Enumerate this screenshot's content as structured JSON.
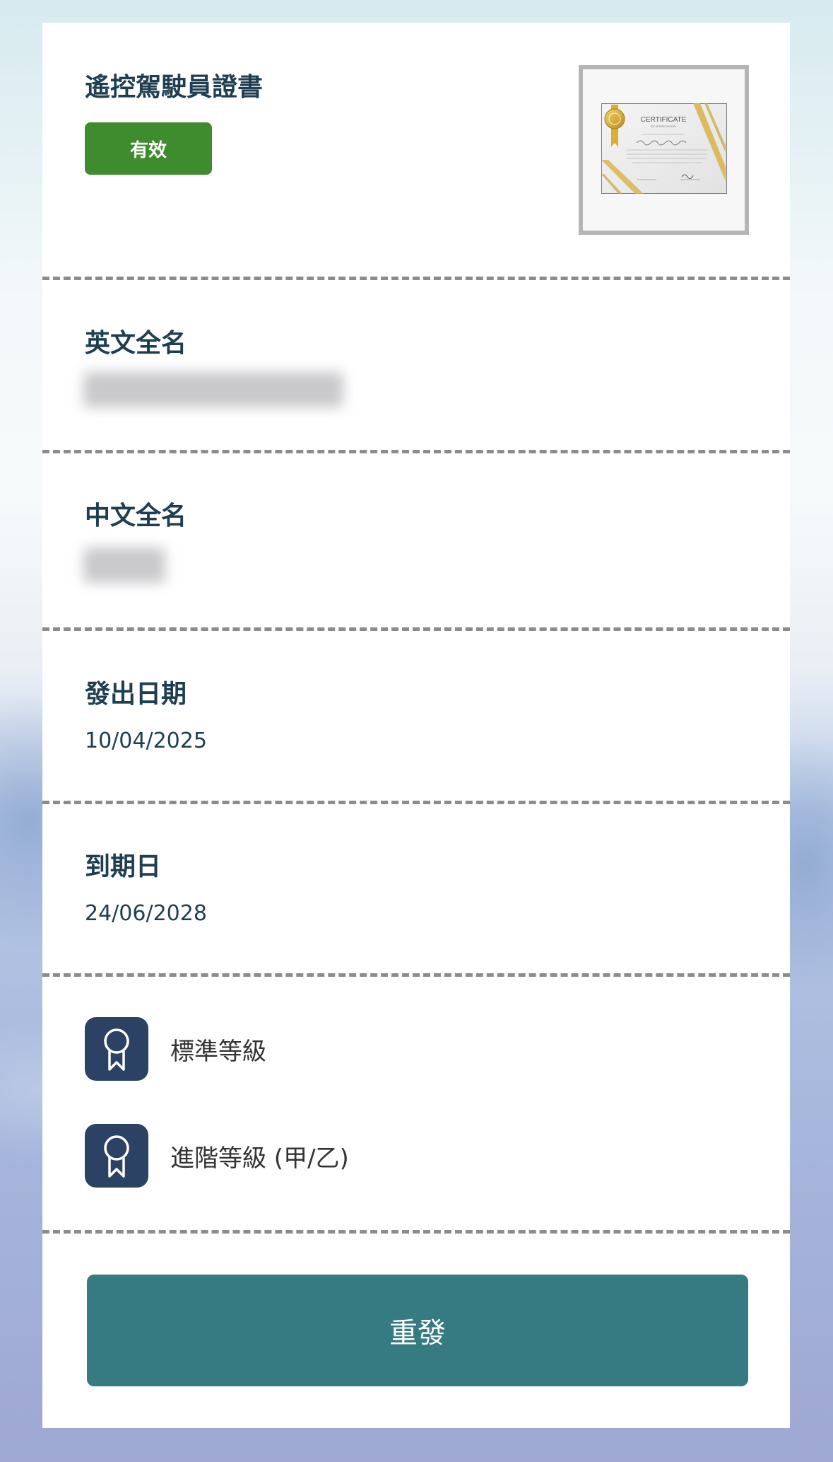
{
  "certificate": {
    "title": "遙控駕駛員證書",
    "status": "有效",
    "status_color": "#3f8c2e",
    "thumbnail": {
      "heading": "CERTIFICATE",
      "subheading": "OF APPRECIATION"
    }
  },
  "fields": {
    "english_name": {
      "label": "英文全名",
      "value_redacted": true
    },
    "chinese_name": {
      "label": "中文全名",
      "value_redacted": true
    },
    "issue_date": {
      "label": "發出日期",
      "value": "10/04/2025"
    },
    "expiry_date": {
      "label": "到期日",
      "value": "24/06/2028"
    }
  },
  "levels": [
    {
      "icon": "award-ribbon-icon",
      "label": "標準等級"
    },
    {
      "icon": "award-ribbon-icon",
      "label": "進階等級 (甲/乙)"
    }
  ],
  "actions": {
    "reissue_label": "重發",
    "reissue_color": "#377b82"
  },
  "colors": {
    "label_text": "#1f3e52",
    "icon_bg": "#2b4264",
    "divider": "#8c8c8c"
  }
}
